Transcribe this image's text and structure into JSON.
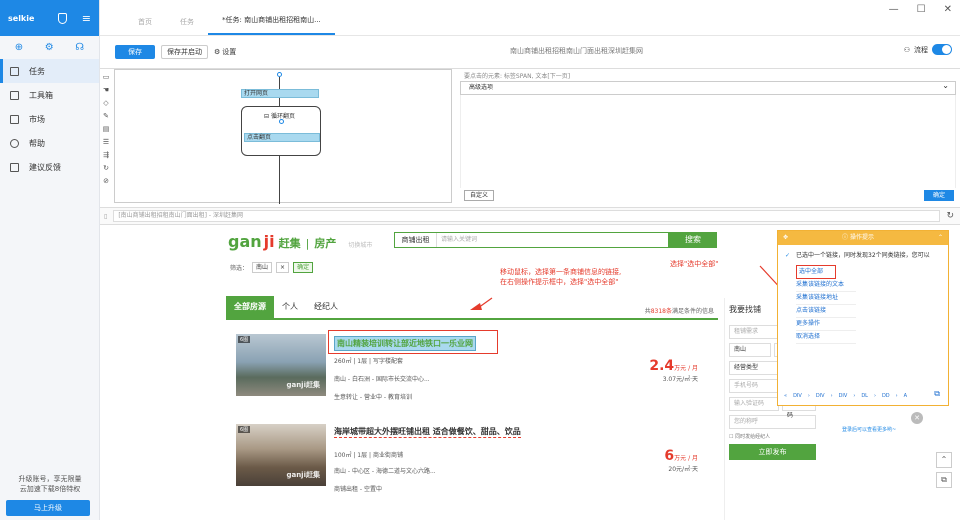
{
  "sidebar": {
    "user": "selkie",
    "items": [
      {
        "label": "任务"
      },
      {
        "label": "工具箱"
      },
      {
        "label": "市场"
      },
      {
        "label": "帮助"
      },
      {
        "label": "建议反馈"
      }
    ],
    "upgrade_text_1": "升级账号，享无限量",
    "upgrade_text_2": "云加速下载8倍特权",
    "upgrade_button": "马上升级"
  },
  "tabs": [
    {
      "label": "首页"
    },
    {
      "label": "任务"
    },
    {
      "label": "*任务: 南山商铺出租招租南山..."
    }
  ],
  "toolbar": {
    "save": "保存",
    "save_start": "保存并启动",
    "settings": "设置",
    "title": "南山商铺出租招租南山门面出租深圳赶集网",
    "flow": "流程"
  },
  "workflow": {
    "open_page": "打开网页",
    "loop_page": "循环翻页",
    "click_page": "点击翻页"
  },
  "props": {
    "current_element": "要点击的元素: 标签SPAN, 文本[下一页]",
    "advanced": "高级选项",
    "custom": "自定义",
    "ok": "确定"
  },
  "urlbar": {
    "url": "[南山商铺出租招租南山门面出租] - 深圳赶集网"
  },
  "site": {
    "logo_zj": "赶集",
    "logo_fc": "房产",
    "city": "切换城市",
    "search_category": "商铺出租",
    "search_placeholder": "请输入关键词",
    "search_button": "搜索",
    "filter_label": "筛选：",
    "filter_chip": "南山",
    "filter_chip_x": "×",
    "filter_confirm": "确定",
    "list_tabs": [
      {
        "label": "全部房源"
      },
      {
        "label": "个人"
      },
      {
        "label": "经纪人"
      }
    ],
    "count_prefix": "共",
    "count_value": "8318条",
    "count_suffix": "满足条件的信息",
    "listings": [
      {
        "photos": "6图",
        "title": "南山精装培训转让部近地铁口一乐业网",
        "meta1": "260㎡ | 1层 | 写字楼配套",
        "meta2": "南山 - 白石洲 - 国际市长交流中心...",
        "meta3": "生意转让 - 营业中 - 教育培训",
        "price": "2.4",
        "price_unit": "万元 / 月",
        "price_sub": "3.07元/㎡·天"
      },
      {
        "photos": "6图",
        "title": "海岸城带超大外摆旺铺出租 适合做餐饮、甜品、饮品",
        "meta1": "100㎡ | 1层 | 商业街商铺",
        "meta2": "南山 - 中心区 - 海德二道与文心六路...",
        "meta3": "商铺出租 - 空置中",
        "price": "6",
        "price_unit": "万元 / 月",
        "price_sub": "20元/㎡·天"
      }
    ],
    "watermark": "ganji赶集",
    "side": {
      "title": "我要找铺",
      "contact": "租铺需求",
      "area": "南山",
      "type": "经营类型",
      "phone": "手机号码",
      "code": "输入验证码",
      "get_code": "获取验证码",
      "name": "您的称呼",
      "agree": "同时发给经纪人",
      "submit": "立即发布"
    }
  },
  "annotations": {
    "move_hint_1": "移动鼠标，选择第一条商铺信息的链接,",
    "move_hint_2": "在右侧操作提示框中，选择\"选中全部\"",
    "select_all_hint": "选择\"选中全部\""
  },
  "tips": {
    "header": "操作提示",
    "message": "已选中一个链接，同时发现32个同类链接，您可以",
    "options": [
      {
        "label": "选中全部"
      },
      {
        "label": "采集该链接的文本"
      },
      {
        "label": "采集该链接地址"
      },
      {
        "label": "点击该链接"
      },
      {
        "label": "更多操作"
      },
      {
        "label": "取消选择"
      }
    ],
    "crumbs": [
      "«",
      "DIV",
      "›",
      "DIV",
      "›",
      "DIV",
      "›",
      "DL",
      "›",
      "DD",
      "›",
      "A"
    ]
  },
  "login_hint": "登录后可以查看更多哟~"
}
